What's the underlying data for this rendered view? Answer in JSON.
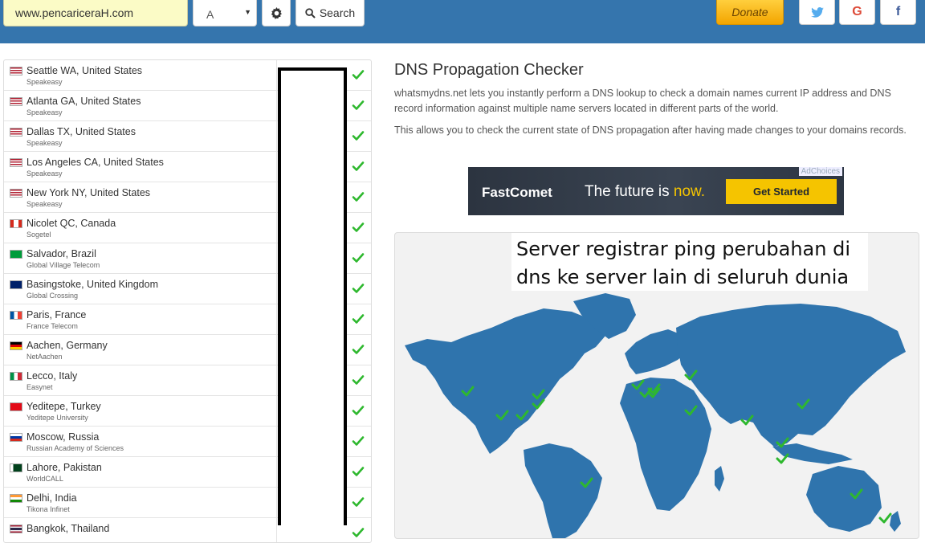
{
  "toolbar": {
    "domain_value": "www.pencariceraH.com",
    "record_type": "A",
    "settings_icon": "gear-icon",
    "search_label": "Search",
    "search_icon": "search-icon",
    "donate_label": "Donate",
    "social_icons": [
      "twitter-icon",
      "google-icon",
      "facebook-icon"
    ]
  },
  "servers": [
    {
      "location": "Seattle WA, United States",
      "provider": "Speakeasy",
      "flag": "us"
    },
    {
      "location": "Atlanta GA, United States",
      "provider": "Speakeasy",
      "flag": "us"
    },
    {
      "location": "Dallas TX, United States",
      "provider": "Speakeasy",
      "flag": "us"
    },
    {
      "location": "Los Angeles CA, United States",
      "provider": "Speakeasy",
      "flag": "us"
    },
    {
      "location": "New York NY, United States",
      "provider": "Speakeasy",
      "flag": "us"
    },
    {
      "location": "Nicolet QC, Canada",
      "provider": "Sogetel",
      "flag": "ca"
    },
    {
      "location": "Salvador, Brazil",
      "provider": "Global Village Telecom",
      "flag": "br"
    },
    {
      "location": "Basingstoke, United Kingdom",
      "provider": "Global Crossing",
      "flag": "gb"
    },
    {
      "location": "Paris, France",
      "provider": "France Telecom",
      "flag": "fr"
    },
    {
      "location": "Aachen, Germany",
      "provider": "NetAachen",
      "flag": "de"
    },
    {
      "location": "Lecco, Italy",
      "provider": "Easynet",
      "flag": "it"
    },
    {
      "location": "Yeditepe, Turkey",
      "provider": "Yeditepe University",
      "flag": "tr"
    },
    {
      "location": "Moscow, Russia",
      "provider": "Russian Academy of Sciences",
      "flag": "ru"
    },
    {
      "location": "Lahore, Pakistan",
      "provider": "WorldCALL",
      "flag": "pk"
    },
    {
      "location": "Delhi, India",
      "provider": "Tikona Infinet",
      "flag": "in"
    },
    {
      "location": "Bangkok, Thailand",
      "provider": "",
      "flag": "th"
    }
  ],
  "main": {
    "title": "DNS Propagation Checker",
    "paragraph1": "whatsmydns.net lets you instantly perform a DNS lookup to check a domain names current IP address and DNS record information against multiple name servers located in different parts of the world.",
    "paragraph2": "This allows you to check the current state of DNS propagation after having made changes to your domains records."
  },
  "ad": {
    "adchoices": "AdChoices",
    "brand": "FastComet",
    "tagline": "The future is",
    "tagline_highlight": "now.",
    "cta": "Get Started"
  },
  "overlay": {
    "line1": "Server registrar ping perubahan di",
    "line2": "dns ke server lain di seluruh dunia"
  },
  "colors": {
    "topbar": "#3575ad",
    "check": "#2eb82e",
    "map_land": "#2f74ad",
    "donate": "#f3a500"
  }
}
